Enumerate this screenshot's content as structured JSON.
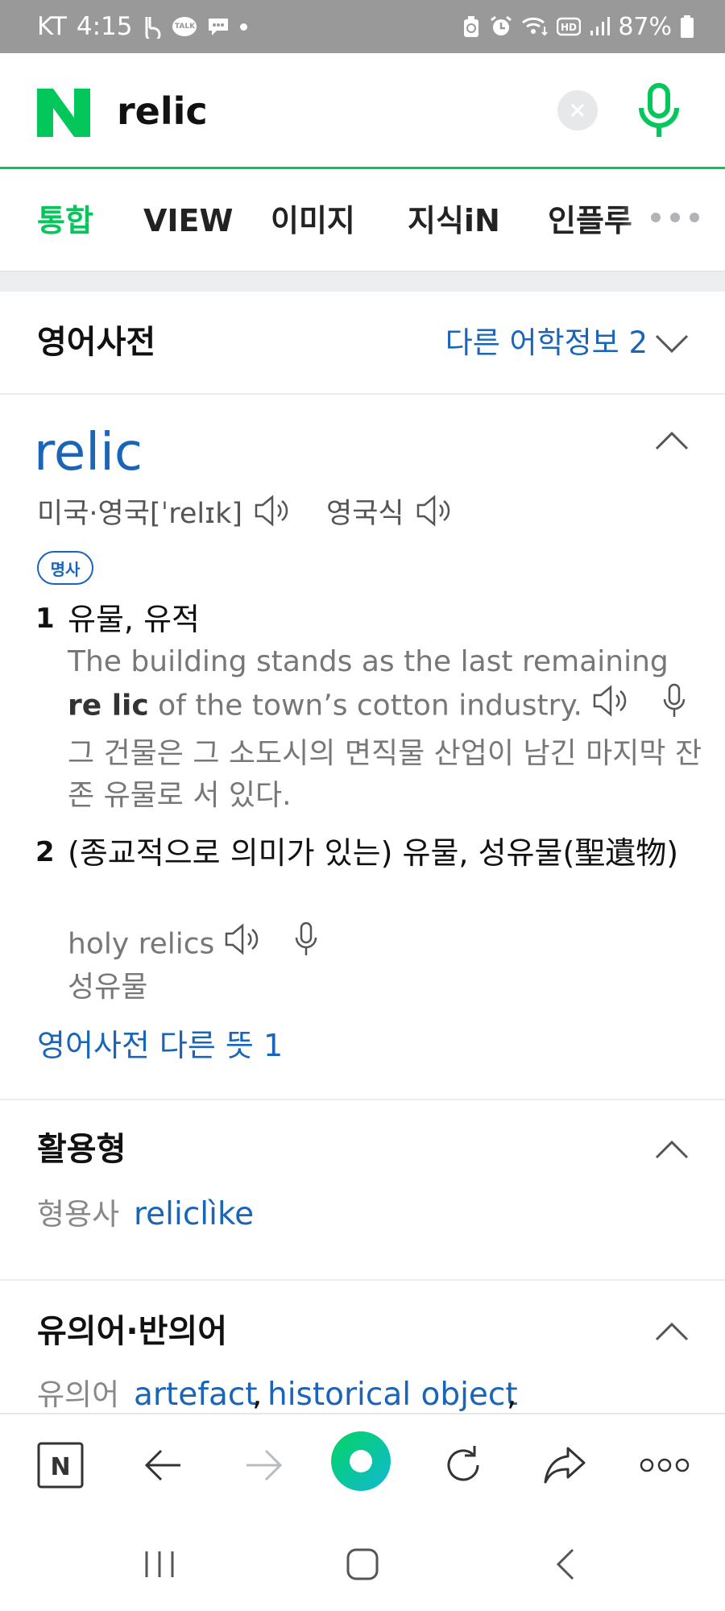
{
  "status_bar": {
    "carrier": "KT",
    "time": "4:15",
    "battery": "87%",
    "icons": [
      "b-icon",
      "talk-icon",
      "chat-icon",
      "dot-icon",
      "recycle-icon",
      "alarm-icon",
      "wifi-icon",
      "hd-icon",
      "signal-icon",
      "battery-icon"
    ],
    "talk_label": "TALK"
  },
  "search": {
    "logo_letter": "N",
    "query": "relic"
  },
  "tabs": [
    {
      "label": "통합",
      "active": true
    },
    {
      "label": "VIEW"
    },
    {
      "label": "이미지"
    },
    {
      "label": "지식iN"
    },
    {
      "label": "인플루"
    }
  ],
  "dictionary": {
    "section_title": "영어사전",
    "other_info_link": "다른 어학정보 2",
    "word": "relic",
    "pron_us_uk": "미국·영국[ˈrelɪk]",
    "pron_uk": "영국식",
    "pos": "명사",
    "definitions": [
      {
        "num": "1",
        "meaning": "유물, 유적",
        "example_pre": "The building stands as the last remaining ",
        "example_highlight": "re lic",
        "example_post": " of the town’s cotton industry.",
        "translation": "그 건물은 그 소도시의 면직물 산업이 남긴 마지막 잔존 유물로 서 있다."
      },
      {
        "num": "2",
        "meaning": "(종교적으로 의미가 있는) 유물, 성유물(聖遺物)",
        "example": "holy relics",
        "translation": "성유물"
      }
    ],
    "more_meanings_link": "영어사전 다른 뜻 1"
  },
  "inflection": {
    "title": "활용형",
    "label": "형용사",
    "value": "reliclìke"
  },
  "synonyms": {
    "title": "유의어·반의어",
    "label": "유의어",
    "value1": "artefact",
    "value2": "historical object",
    "sep": ","
  },
  "toolbar": {
    "home_letter": "N"
  },
  "colors": {
    "brand_green": "#03c75a",
    "link_blue": "#1a65b8",
    "status_bar": "#999999"
  }
}
